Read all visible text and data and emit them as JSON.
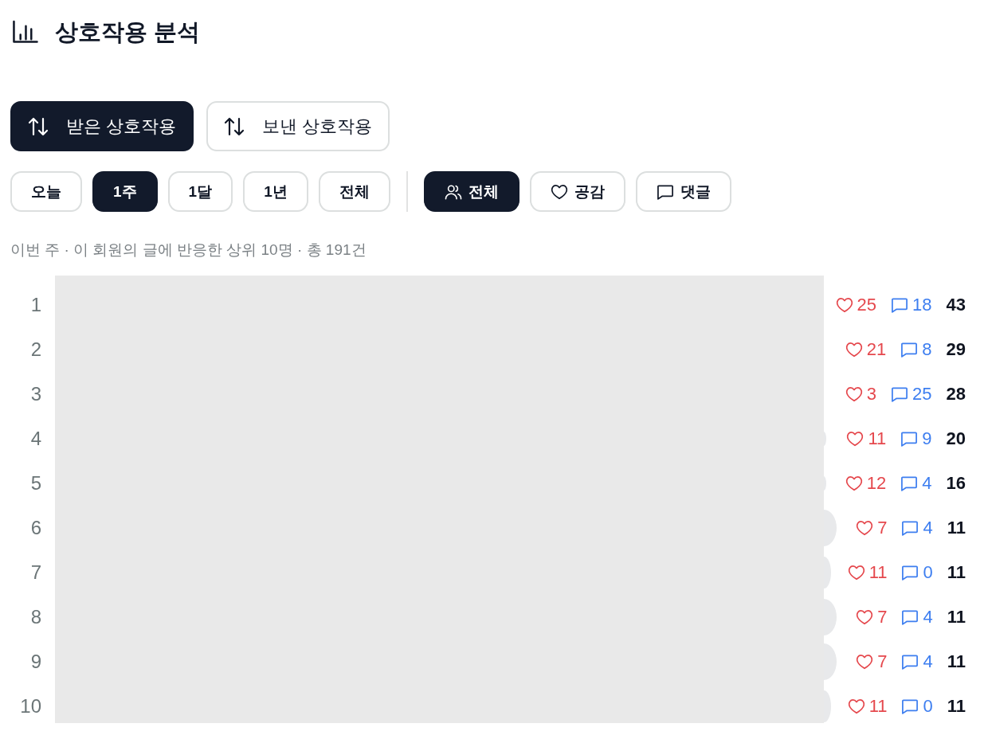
{
  "header": {
    "title": "상호작용 분석"
  },
  "direction_tabs": [
    {
      "label": "받은 상호작용",
      "selected": true
    },
    {
      "label": "보낸 상호작용",
      "selected": false
    }
  ],
  "period_filters": [
    {
      "label": "오늘",
      "selected": false
    },
    {
      "label": "1주",
      "selected": true
    },
    {
      "label": "1달",
      "selected": false
    },
    {
      "label": "1년",
      "selected": false
    },
    {
      "label": "전체",
      "selected": false
    }
  ],
  "type_filters": [
    {
      "kind": "all",
      "label": "전체",
      "selected": true
    },
    {
      "kind": "like",
      "label": "공감",
      "selected": false
    },
    {
      "kind": "comment",
      "label": "댓글",
      "selected": false
    }
  ],
  "summary": "이번 주 · 이 회원의 글에 반응한 상위 10명 · 총 191건",
  "ranking": {
    "rows": [
      {
        "rank": "1",
        "likes": "25",
        "comments": "18",
        "total": "43"
      },
      {
        "rank": "2",
        "likes": "21",
        "comments": "8",
        "total": "29"
      },
      {
        "rank": "3",
        "likes": "3",
        "comments": "25",
        "total": "28"
      },
      {
        "rank": "4",
        "likes": "11",
        "comments": "9",
        "total": "20"
      },
      {
        "rank": "5",
        "likes": "12",
        "comments": "4",
        "total": "16"
      },
      {
        "rank": "6",
        "likes": "7",
        "comments": "4",
        "total": "11"
      },
      {
        "rank": "7",
        "likes": "11",
        "comments": "0",
        "total": "11"
      },
      {
        "rank": "8",
        "likes": "7",
        "comments": "4",
        "total": "11"
      },
      {
        "rank": "9",
        "likes": "7",
        "comments": "4",
        "total": "11"
      },
      {
        "rank": "10",
        "likes": "11",
        "comments": "0",
        "total": "11"
      }
    ]
  }
}
